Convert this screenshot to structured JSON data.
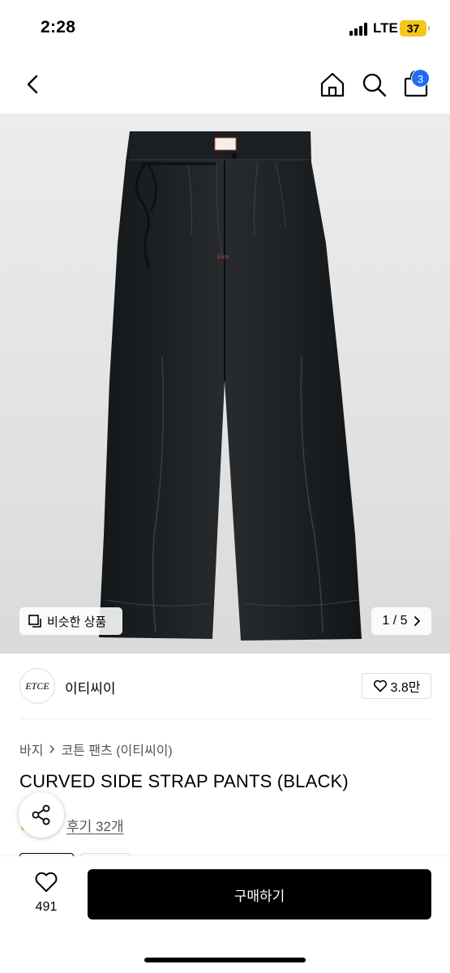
{
  "status_bar": {
    "time": "2:28",
    "network": "LTE",
    "battery": "37"
  },
  "nav": {
    "back_icon": "chevron-left-icon",
    "home_icon": "home-icon",
    "search_icon": "search-icon",
    "bag_icon": "shopping-bag-icon",
    "bag_count": "3"
  },
  "hero": {
    "logo_tag": "Etce",
    "similar_label": "비슷한 상품",
    "page_indicator": "1 / 5"
  },
  "brand": {
    "logo": "ETCE",
    "name": "이티씨이",
    "likes": "3.8만"
  },
  "breadcrumb": {
    "category": "바지",
    "subcategory": "코튼 팬츠 (이티씨이)"
  },
  "product": {
    "title": "CURVED SIDE STRAP PANTS (BLACK)"
  },
  "reviews": {
    "label": "후기 32개"
  },
  "bottom_bar": {
    "wish_count": "491",
    "buy_label": "구매하기"
  },
  "colors": {
    "accent": "#1e6cf3",
    "battery": "#f5c518",
    "star": "#f6a623",
    "buy_button": "#000000"
  }
}
